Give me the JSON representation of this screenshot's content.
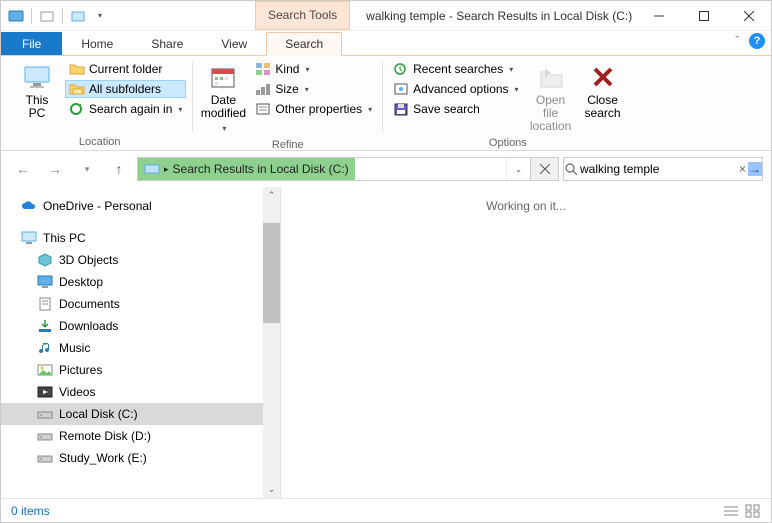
{
  "titlebar": {
    "contextual_label": "Search Tools",
    "title": "walking temple - Search Results in Local Disk (C:)"
  },
  "tabs": {
    "file": "File",
    "home": "Home",
    "share": "Share",
    "view": "View",
    "search": "Search"
  },
  "ribbon": {
    "location": {
      "label": "Location",
      "this_pc": "This\nPC",
      "current_folder": "Current folder",
      "all_subfolders": "All subfolders",
      "search_again_in": "Search again in"
    },
    "refine": {
      "label": "Refine",
      "date_modified": "Date\nmodified",
      "kind": "Kind",
      "size": "Size",
      "other_properties": "Other properties"
    },
    "options": {
      "label": "Options",
      "recent_searches": "Recent searches",
      "advanced_options": "Advanced options",
      "save_search": "Save search",
      "open_file_location": "Open file\nlocation",
      "close_search": "Close\nsearch"
    }
  },
  "nav": {
    "address_text": "Search Results in Local Disk (C:)"
  },
  "search": {
    "value": "walking temple"
  },
  "tree": {
    "onedrive": "OneDrive - Personal",
    "this_pc": "This PC",
    "items": [
      {
        "label": "3D Objects",
        "icon": "cube"
      },
      {
        "label": "Desktop",
        "icon": "desktop"
      },
      {
        "label": "Documents",
        "icon": "doc"
      },
      {
        "label": "Downloads",
        "icon": "download"
      },
      {
        "label": "Music",
        "icon": "music"
      },
      {
        "label": "Pictures",
        "icon": "pictures"
      },
      {
        "label": "Videos",
        "icon": "videos"
      },
      {
        "label": "Local Disk (C:)",
        "icon": "drive",
        "selected": true
      },
      {
        "label": "Remote Disk (D:)",
        "icon": "drive"
      },
      {
        "label": "Study_Work (E:)",
        "icon": "drive"
      }
    ]
  },
  "content": {
    "status_text": "Working on it..."
  },
  "statusbar": {
    "items": "0 items"
  }
}
